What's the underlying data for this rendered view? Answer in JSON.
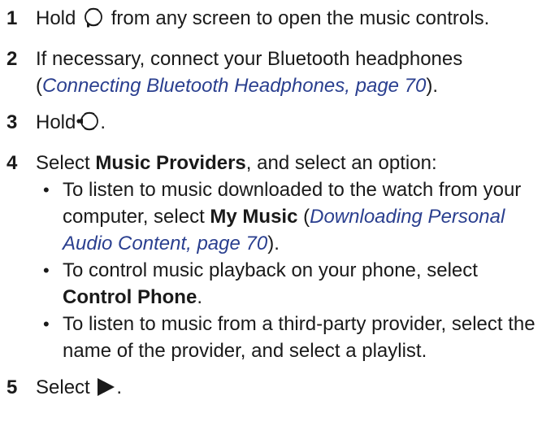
{
  "steps": [
    {
      "num": "1",
      "pre": "Hold",
      "icon": "watch-button-icon",
      "post": "from any screen to open the music controls."
    },
    {
      "num": "2",
      "pre": "If necessary, connect your Bluetooth headphones (",
      "link": "Connecting Bluetooth Headphones, page 70",
      "post": ")."
    },
    {
      "num": "3",
      "pre": "Hold",
      "icon": "menu-button-icon",
      "post": "."
    },
    {
      "num": "4",
      "pre": "Select",
      "bold": "Music Providers",
      "post": ", and select an option:",
      "options": [
        {
          "pre": "To listen to music downloaded to the watch from your computer, select",
          "bold": "My Music",
          "mid": " (",
          "link": "Downloading Personal Audio Content, page 70",
          "post": ")."
        },
        {
          "pre": "To control music playback on your phone, select",
          "bold": "Control Phone",
          "post": "."
        },
        {
          "text": "To listen to music from a third-party provider, select the name of the provider, and select a playlist."
        }
      ]
    },
    {
      "num": "5",
      "pre": "Select",
      "icon": "play-icon",
      "post": "."
    }
  ],
  "bullet_char": "•"
}
